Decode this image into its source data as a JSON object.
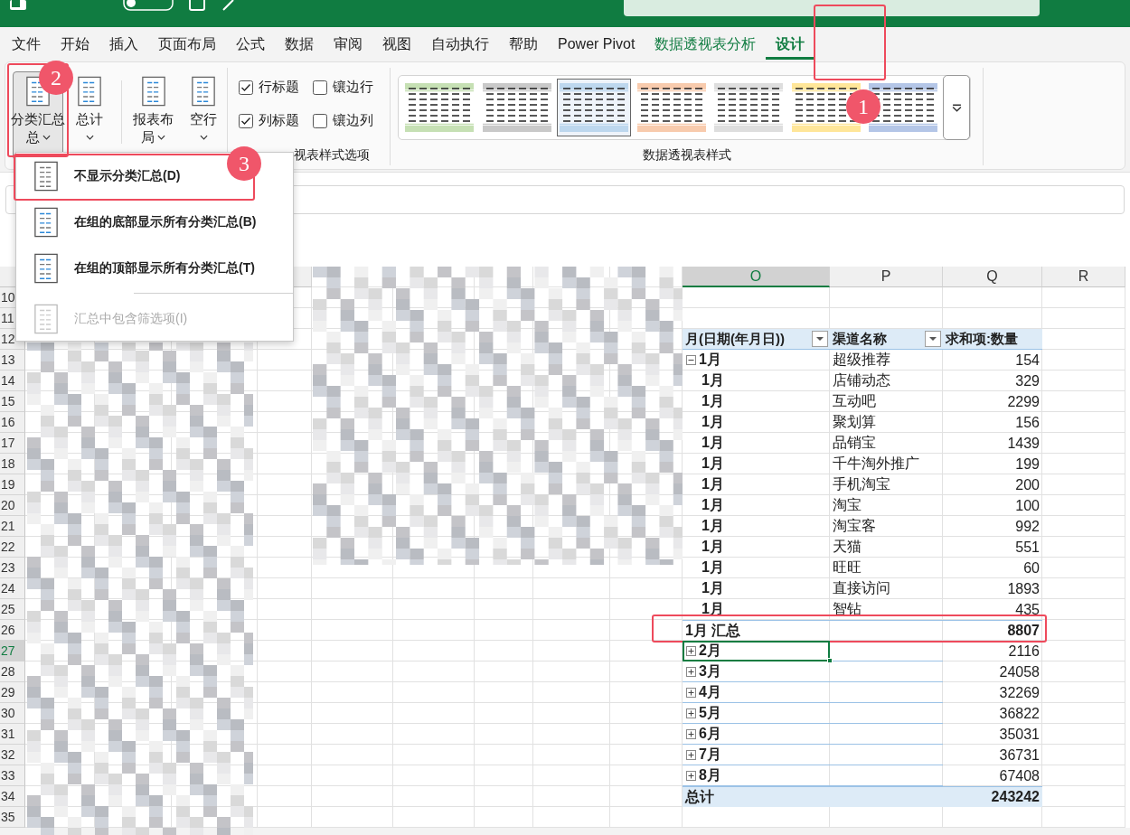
{
  "menu_tabs": [
    {
      "label": "文件",
      "kind": "normal",
      "selected": false
    },
    {
      "label": "开始",
      "kind": "normal",
      "selected": false
    },
    {
      "label": "插入",
      "kind": "normal",
      "selected": false
    },
    {
      "label": "页面布局",
      "kind": "normal",
      "selected": false
    },
    {
      "label": "公式",
      "kind": "normal",
      "selected": false
    },
    {
      "label": "数据",
      "kind": "normal",
      "selected": false
    },
    {
      "label": "审阅",
      "kind": "normal",
      "selected": false
    },
    {
      "label": "视图",
      "kind": "normal",
      "selected": false
    },
    {
      "label": "自动执行",
      "kind": "normal",
      "selected": false
    },
    {
      "label": "帮助",
      "kind": "normal",
      "selected": false
    },
    {
      "label": "Power Pivot",
      "kind": "normal",
      "selected": false
    },
    {
      "label": "数据透视表分析",
      "kind": "contextual",
      "selected": false
    },
    {
      "label": "设计",
      "kind": "contextual",
      "selected": true
    }
  ],
  "ribbon": {
    "layout_buttons": [
      {
        "label": "分类汇总",
        "label_2": "总",
        "pressed": true
      },
      {
        "label": "总计",
        "pressed": false
      },
      {
        "label": "报表布",
        "label_2": "局",
        "pressed": false
      },
      {
        "label": "空行",
        "pressed": false
      }
    ],
    "options": {
      "checkboxes": [
        {
          "label": "行标题",
          "checked": true
        },
        {
          "label": "镶边行",
          "checked": false
        },
        {
          "label": "列标题",
          "checked": true
        },
        {
          "label": "镶边列",
          "checked": false
        }
      ],
      "group_label": "视表样式选项"
    },
    "styles": {
      "swatches": [
        {
          "color": "#c6e0b4",
          "selected": false
        },
        {
          "color": "#c9c9c9",
          "selected": false
        },
        {
          "color": "#bdd7ee",
          "selected": true
        },
        {
          "color": "#f8cbad",
          "selected": false
        },
        {
          "color": "#dedede",
          "selected": false
        },
        {
          "color": "#ffe699",
          "selected": false
        },
        {
          "color": "#b4c6e7",
          "selected": false
        }
      ],
      "group_label": "数据透视表样式"
    }
  },
  "subtotal_menu": [
    {
      "label": "不显示分类汇总(D)",
      "disabled": false
    },
    {
      "label": "在组的底部显示所有分类汇总(B)",
      "disabled": false
    },
    {
      "label": "在组的顶部显示所有分类汇总(T)",
      "disabled": false
    },
    {
      "label": "汇总中包含筛选项(I)",
      "disabled": true
    }
  ],
  "sheet": {
    "columns": [
      {
        "letter": "O",
        "selected": true
      },
      {
        "letter": "P",
        "selected": false
      },
      {
        "letter": "Q",
        "selected": false
      },
      {
        "letter": "R",
        "selected": false
      }
    ],
    "row_numbers": [
      "10",
      "11",
      "12",
      "13",
      "14",
      "15",
      "16",
      "17",
      "18",
      "19",
      "20",
      "21",
      "22",
      "23",
      "24",
      "25",
      "26",
      "27",
      "28",
      "29",
      "30",
      "31",
      "32",
      "33",
      "34",
      "35"
    ]
  },
  "pivot": {
    "headers": [
      {
        "label": "月(日期(年月日))",
        "filter": true
      },
      {
        "label": "渠道名称",
        "filter": true
      },
      {
        "label": "求和项:数量",
        "filter": false
      }
    ],
    "rows": [
      {
        "kind": "detail",
        "month": "1月",
        "expanded": true,
        "channel": "超级推荐",
        "value": "154",
        "selected": false
      },
      {
        "kind": "detail",
        "month": "1月",
        "channel": "店铺动态",
        "value": "329",
        "selected": false
      },
      {
        "kind": "detail",
        "month": "1月",
        "channel": "互动吧",
        "value": "2299",
        "selected": false
      },
      {
        "kind": "detail",
        "month": "1月",
        "channel": "聚划算",
        "value": "156",
        "selected": false
      },
      {
        "kind": "detail",
        "month": "1月",
        "channel": "品销宝",
        "value": "1439",
        "selected": false
      },
      {
        "kind": "detail",
        "month": "1月",
        "channel": "千牛淘外推广",
        "value": "199",
        "selected": false
      },
      {
        "kind": "detail",
        "month": "1月",
        "channel": "手机淘宝",
        "value": "200",
        "selected": false
      },
      {
        "kind": "detail",
        "month": "1月",
        "channel": "淘宝",
        "value": "100",
        "selected": false
      },
      {
        "kind": "detail",
        "month": "1月",
        "channel": "淘宝客",
        "value": "992",
        "selected": false
      },
      {
        "kind": "detail",
        "month": "1月",
        "channel": "天猫",
        "value": "551",
        "selected": false
      },
      {
        "kind": "detail",
        "month": "1月",
        "channel": "旺旺",
        "value": "60",
        "selected": false
      },
      {
        "kind": "detail",
        "month": "1月",
        "channel": "直接访问",
        "value": "1893",
        "selected": false
      },
      {
        "kind": "detail",
        "month": "1月",
        "channel": "智钻",
        "value": "435",
        "selected": false
      },
      {
        "kind": "subtotal",
        "month": "1月 汇总",
        "value": "8807",
        "selected": false
      },
      {
        "kind": "group",
        "month": "2月",
        "expanded": false,
        "value": "2116",
        "selected": true
      },
      {
        "kind": "group",
        "month": "3月",
        "expanded": false,
        "value": "24058",
        "selected": false
      },
      {
        "kind": "group",
        "month": "4月",
        "expanded": false,
        "value": "32269",
        "selected": false
      },
      {
        "kind": "group",
        "month": "5月",
        "expanded": false,
        "value": "36822",
        "selected": false
      },
      {
        "kind": "group",
        "month": "6月",
        "expanded": false,
        "value": "35031",
        "selected": false
      },
      {
        "kind": "group",
        "month": "7月",
        "expanded": false,
        "value": "36731",
        "selected": false
      },
      {
        "kind": "group",
        "month": "8月",
        "expanded": false,
        "value": "67408",
        "selected": false
      },
      {
        "kind": "total",
        "month": "总计",
        "value": "243242",
        "selected": false
      }
    ]
  },
  "annotations": [
    {
      "number": "1"
    },
    {
      "number": "2"
    },
    {
      "number": "3"
    }
  ]
}
